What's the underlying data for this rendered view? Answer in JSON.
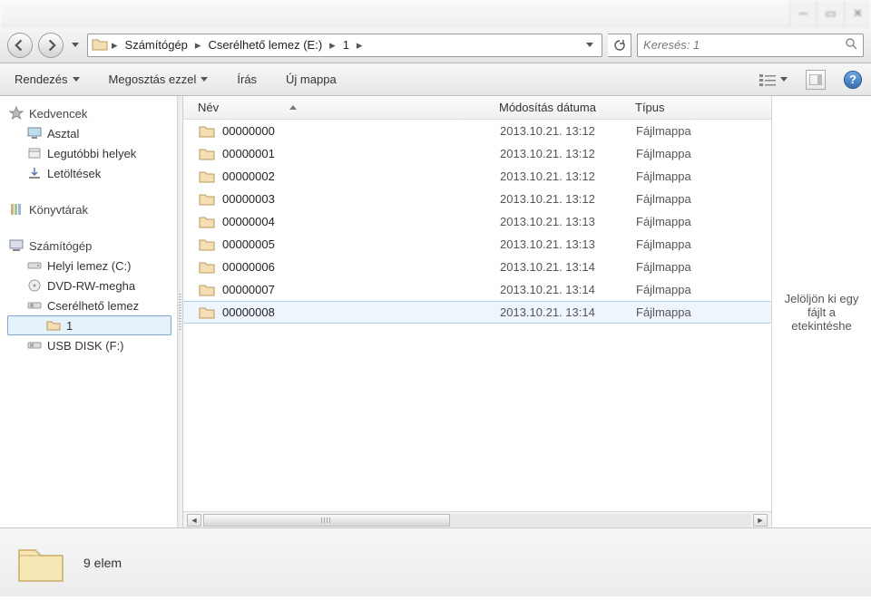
{
  "breadcrumb": {
    "seg0": "Számítógép",
    "seg1": "Cserélhető lemez (E:)",
    "seg2": "1"
  },
  "search": {
    "placeholder": "Keresés: 1"
  },
  "toolbar": {
    "organize": "Rendezés",
    "share": "Megosztás ezzel",
    "burn": "Írás",
    "newfolder": "Új mappa"
  },
  "sidebar": {
    "fav_head": "Kedvencek",
    "fav_desktop": "Asztal",
    "fav_recent": "Legutóbbi helyek",
    "fav_downloads": "Letöltések",
    "lib_head": "Könyvtárak",
    "comp_head": "Számítógép",
    "comp_c": "Helyi lemez (C:)",
    "comp_dvd": "DVD-RW-megha",
    "comp_e": "Cserélhető lemez",
    "comp_e_sub": "1",
    "comp_f": "USB DISK (F:)"
  },
  "columns": {
    "name": "Név",
    "date": "Módosítás dátuma",
    "type": "Típus"
  },
  "files": [
    {
      "name": "00000000",
      "date": "2013.10.21. 13:12",
      "type": "Fájlmappa"
    },
    {
      "name": "00000001",
      "date": "2013.10.21. 13:12",
      "type": "Fájlmappa"
    },
    {
      "name": "00000002",
      "date": "2013.10.21. 13:12",
      "type": "Fájlmappa"
    },
    {
      "name": "00000003",
      "date": "2013.10.21. 13:12",
      "type": "Fájlmappa"
    },
    {
      "name": "00000004",
      "date": "2013.10.21. 13:13",
      "type": "Fájlmappa"
    },
    {
      "name": "00000005",
      "date": "2013.10.21. 13:13",
      "type": "Fájlmappa"
    },
    {
      "name": "00000006",
      "date": "2013.10.21. 13:14",
      "type": "Fájlmappa"
    },
    {
      "name": "00000007",
      "date": "2013.10.21. 13:14",
      "type": "Fájlmappa"
    },
    {
      "name": "00000008",
      "date": "2013.10.21. 13:14",
      "type": "Fájlmappa"
    }
  ],
  "preview_hint": "Jelöljön ki egy fájlt a etekintéshe",
  "status": {
    "count": "9 elem"
  }
}
